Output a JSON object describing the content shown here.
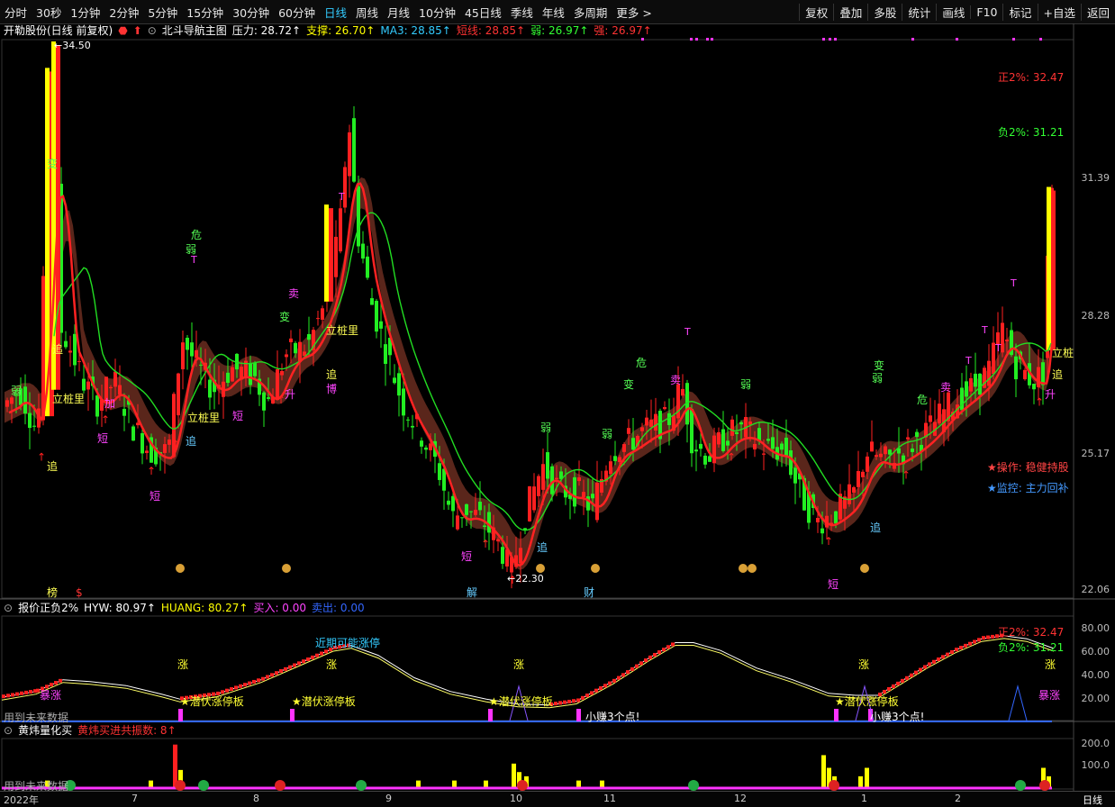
{
  "toolbar": {
    "periods": [
      "分时",
      "30秒",
      "1分钟",
      "2分钟",
      "5分钟",
      "15分钟",
      "30分钟",
      "60分钟",
      "日线",
      "周线",
      "月线",
      "10分钟",
      "45日线",
      "季线",
      "年线",
      "多周期",
      "更多 >"
    ],
    "active_period": "日线",
    "actions": [
      "复权",
      "叠加",
      "多股",
      "统计",
      "画线",
      "F10",
      "标记",
      "+自选",
      "返回"
    ]
  },
  "main_info": {
    "stock": "开勒股份(日线 前复权)",
    "indicator": "北斗导航主图",
    "pressure": "压力: 28.72↑",
    "support": "支撑: 26.70↑",
    "ma3": "MA3: 28.85↑",
    "short": "短线: 28.85↑",
    "weak": "弱: 26.97↑",
    "strong": "强: 26.97↑"
  },
  "price_axis": [
    "31.39",
    "28.28",
    "25.17",
    "22.06"
  ],
  "price_marks": {
    "high": "34.50",
    "low": "22.30"
  },
  "right_panel": {
    "pos2": "正2%: 32.47",
    "neg2": "负2%: 31.21",
    "op": "★操作: 稳健持股",
    "monitor": "★监控: 主力回补"
  },
  "mid_info": {
    "name": "报价正负2%",
    "hyw": "HYW: 80.97↑",
    "huang": "HUANG: 80.27↑",
    "buy": "买入: 0.00",
    "sell": "卖出: 0.00"
  },
  "mid_axis": [
    "80.00",
    "60.00",
    "40.00",
    "20.00"
  ],
  "mid_texts": {
    "near": "近期可能涨停",
    "hidden": "★潜伏涨停板",
    "earn": "小赚3个点!",
    "future": "用到未来数据",
    "zhang": "涨",
    "burst": "暴涨",
    "pos2": "正2%: 32.47",
    "neg2": "负2%: 31.21"
  },
  "bot_info": {
    "name": "黄炜量化买",
    "count": "黄炜买进共振数: 8↑"
  },
  "bot_axis": [
    "200.0",
    "100.0"
  ],
  "status": {
    "year": "2022年",
    "months": [
      "7",
      "8",
      "9",
      "10",
      "11",
      "12",
      "1",
      "2"
    ],
    "period": "日线"
  },
  "colors": {
    "up": "#ff2020",
    "down": "#22ee22",
    "yellow": "#ffff00",
    "magenta": "#ff33ff",
    "blue": "#3366ff"
  }
}
